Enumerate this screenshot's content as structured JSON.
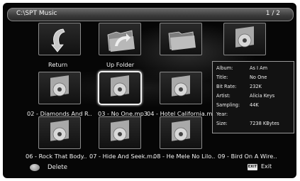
{
  "header": {
    "path": "C:\\SPT Music",
    "page": "1 / 2"
  },
  "grid": {
    "row1": [
      {
        "label": "",
        "icon": "return-arrow-icon"
      },
      {
        "label": "",
        "icon": "up-folder-icon"
      },
      {
        "label": "",
        "icon": "folder-icon"
      },
      {
        "label": "",
        "icon": "disc-icon"
      }
    ],
    "row1_labels": [
      "Return",
      "Up Folder"
    ],
    "row2_labels": [
      "02 - Diamonds And R..",
      "03 - No One.mp3",
      "04 - Hotel California.m.."
    ],
    "row3_labels": [
      "06 - Rock That Body..",
      "07 - Hide And Seek.m..",
      "08 - He Mele No Lilo..",
      "09 - Bird On A Wire.."
    ]
  },
  "info": {
    "rows": [
      {
        "key": "Album:",
        "value": "As I Am"
      },
      {
        "key": "Title:",
        "value": "No One"
      },
      {
        "key": "Bit Rate:",
        "value": "232K"
      },
      {
        "key": "Artist:",
        "value": "Alicia Keys"
      },
      {
        "key": "Sampling:",
        "value": "44K"
      },
      {
        "key": "Year:",
        "value": ""
      },
      {
        "key": "Size:",
        "value": "7238 KBytes"
      }
    ]
  },
  "footer": {
    "delete_label": "Delete",
    "exit_key": "EXIT",
    "exit_label": "Exit"
  },
  "colors": {
    "background": "#060606",
    "text": "#f4f4f4",
    "selected_border": "#f0f0f0"
  }
}
